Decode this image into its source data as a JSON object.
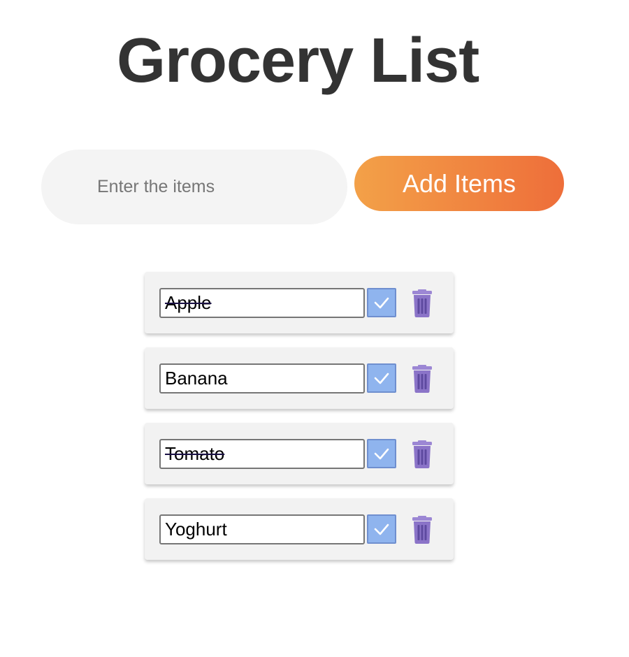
{
  "header": {
    "title": "Grocery List"
  },
  "form": {
    "placeholder": "Enter the items",
    "add_label": "Add Items"
  },
  "items": [
    {
      "name": "Apple",
      "completed": true
    },
    {
      "name": "Banana",
      "completed": false
    },
    {
      "name": "Tomato",
      "completed": true
    },
    {
      "name": "Yoghurt",
      "completed": false
    }
  ],
  "icons": {
    "complete": "checkmark-icon",
    "delete": "trash-icon"
  },
  "colors": {
    "title": "#333333",
    "input_bg": "#f4f4f4",
    "button_gradient_start": "#f3a148",
    "button_gradient_end": "#ee6e3a",
    "card_bg": "#f2f2f2",
    "check_bg": "#8fb4ee",
    "trash": "#8b74c8"
  }
}
